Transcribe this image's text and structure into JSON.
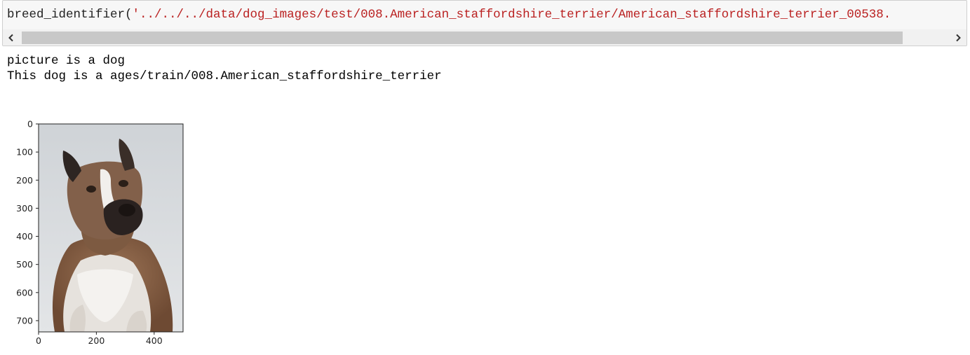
{
  "code_cell": {
    "func": "breed_identifier(",
    "arg": "'../../../data/dog_images/test/008.American_staffordshire_terrier/American_staffordshire_terrier_00538.",
    "scrollbar": {
      "left_icon": "chevron-left-icon",
      "right_icon": "chevron-right-icon",
      "thumb_fraction": 0.95
    }
  },
  "output": {
    "line1": "picture is a dog",
    "line2": "This dog is a ages/train/008.American_staffordshire_terrier"
  },
  "image_plot": {
    "image_width": 500,
    "image_height": 740,
    "y_ticks": [
      "0",
      "100",
      "200",
      "300",
      "400",
      "500",
      "600",
      "700"
    ],
    "x_ticks": [
      "0",
      "200",
      "400"
    ],
    "image_description_icon": "dog-photo"
  },
  "colors": {
    "cell_bg": "#f7f7f7",
    "cell_border": "#cfcfcf",
    "string_color": "#ba2121",
    "scroll_thumb": "#c8c8c8"
  }
}
